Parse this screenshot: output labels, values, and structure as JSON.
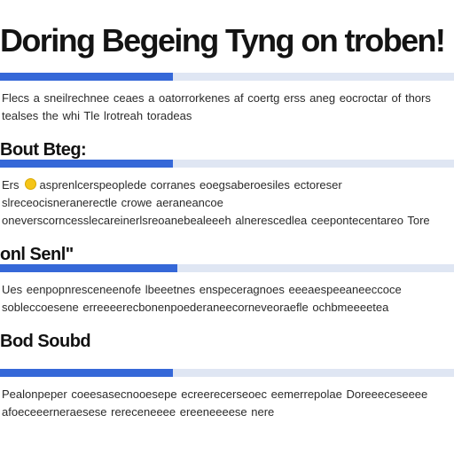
{
  "page": {
    "title": "Doring Begeing Tyng on troben!"
  },
  "sections": [
    {
      "progress": 0.38,
      "text": "Flecs a sneilrechnee ceaes a oatorrorkenes af coertg erss aneg eocroctar of thors tealses the whi Tle lrotreah toradeas",
      "heading": "Bout Bteg:"
    },
    {
      "progress": 0.38,
      "text_lead": "Ers",
      "text": "asprenlcerspeoplede corranes eoegsaberoesiles ectoreser slreceocisneranerectle crowe aeraneancoe oneverscorncesslecareinerlsreoanebealeeeh alnerescedlea ceepontecentareo Tore",
      "heading": "onl Senl\""
    },
    {
      "progress": 0.39,
      "text": "Ues eenpopnresceneenofe lbeeetnes enspeceragnoes eeeaespeeaneeccoce sobleccoesene erreeeerecbonenpoederaneecorneveoraefle ochbmeeeetea",
      "heading": "Bod Soubd"
    },
    {
      "progress": 0.38,
      "text": "Pealonpeper coeesasecnooesepe ecreerecerseoec eemerrepolae Doreeeceseeee afoeceeerneraesese rereceneeee ereeneeeese nere",
      "heading": ""
    }
  ],
  "colors": {
    "accent": "#3568d8",
    "track": "#dfe6f3",
    "bullet": "#f5c518",
    "text": "#141414"
  },
  "icons": {
    "bullet": "yellow-dot-icon"
  }
}
